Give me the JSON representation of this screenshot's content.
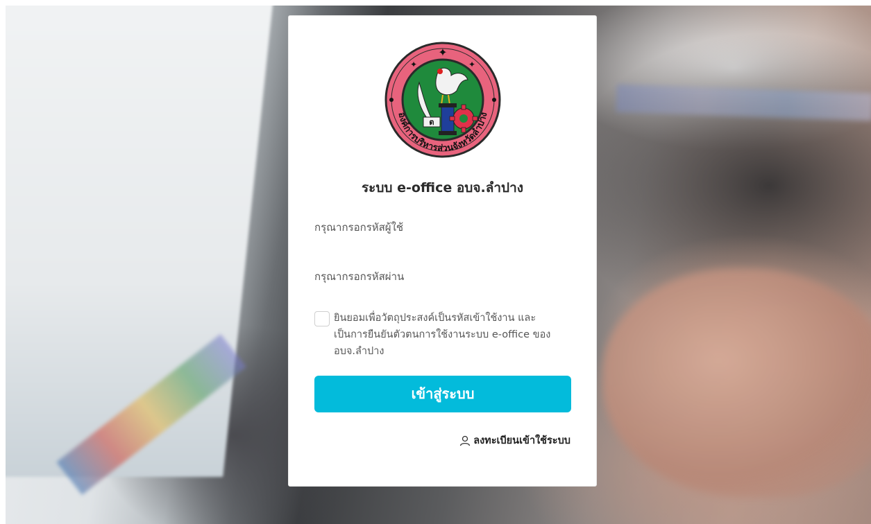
{
  "login": {
    "title": "ระบบ e-office อบจ.ลำปาง",
    "username_placeholder": "กรุณากรอกรหัสผู้ใช้",
    "password_placeholder": "กรุณากรอกรหัสผ่าน",
    "consent_text": "ยินยอมเพื่อวัตถุประสงค์เป็นรหัสเข้าใช้งาน และเป็นการยืนยันตัวตนการใช้งานระบบ e-office ของ อบจ.ลำปาง",
    "consent_checked": false,
    "login_button": "เข้าสู่ระบบ",
    "register_link": "ลงทะเบียนเข้าใช้ระบบ",
    "logo_text": "องค์การบริหารส่วนจังหวัดลำปาง"
  },
  "icons": {
    "register": "user-icon",
    "logo": "emblem-icon"
  },
  "colors": {
    "accent": "#03bbdb",
    "logo_ring": "#e8637d",
    "logo_center": "#1f8a3c",
    "logo_blue": "#1f3f9a",
    "logo_gear": "#e0314a"
  }
}
